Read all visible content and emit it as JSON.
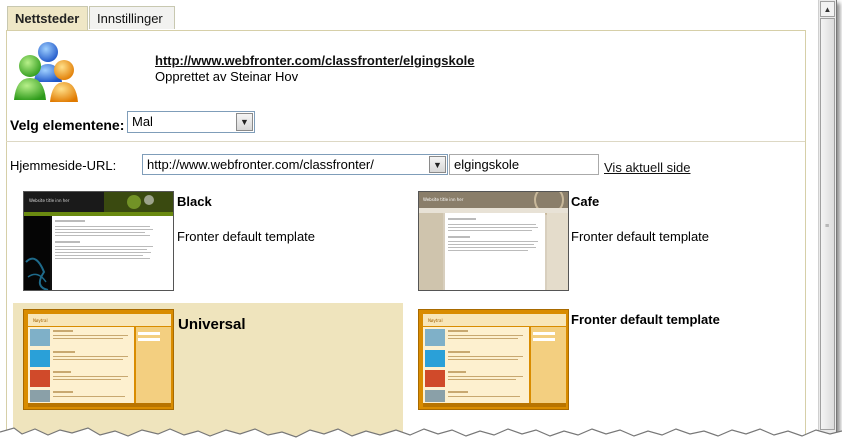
{
  "tabs": [
    {
      "label": "Nettsteder",
      "active": true
    },
    {
      "label": "Innstillinger",
      "active": false
    }
  ],
  "site": {
    "url": "http://www.webfronter.com/classfronter/elgingskole",
    "created_by": "Opprettet av Steinar Hov"
  },
  "elements": {
    "label": "Velg elementene:",
    "selected": "Mal"
  },
  "homepage": {
    "label": "Hjemmeside-URL:",
    "base_url": "http://www.webfronter.com/classfronter/",
    "slug": "elgingskole",
    "view_link": "Vis aktuell side"
  },
  "templates": [
    {
      "name": "Black",
      "description": "Fronter default template",
      "thumb_header": "Website title inn her",
      "selected": false
    },
    {
      "name": "Cafe",
      "description": "Fronter default template",
      "thumb_header": "Website title inn her",
      "selected": false
    },
    {
      "name": "Universal",
      "description": "",
      "thumb_header": "Nøytral",
      "selected": true
    },
    {
      "name": "Fronter default template",
      "description": "",
      "thumb_header": "Nøytral",
      "selected": false
    }
  ],
  "colors": {
    "active_tab": "#efe7c6",
    "selected_template_bg": "#efe4bd",
    "universal_orange": "#d98c00"
  }
}
